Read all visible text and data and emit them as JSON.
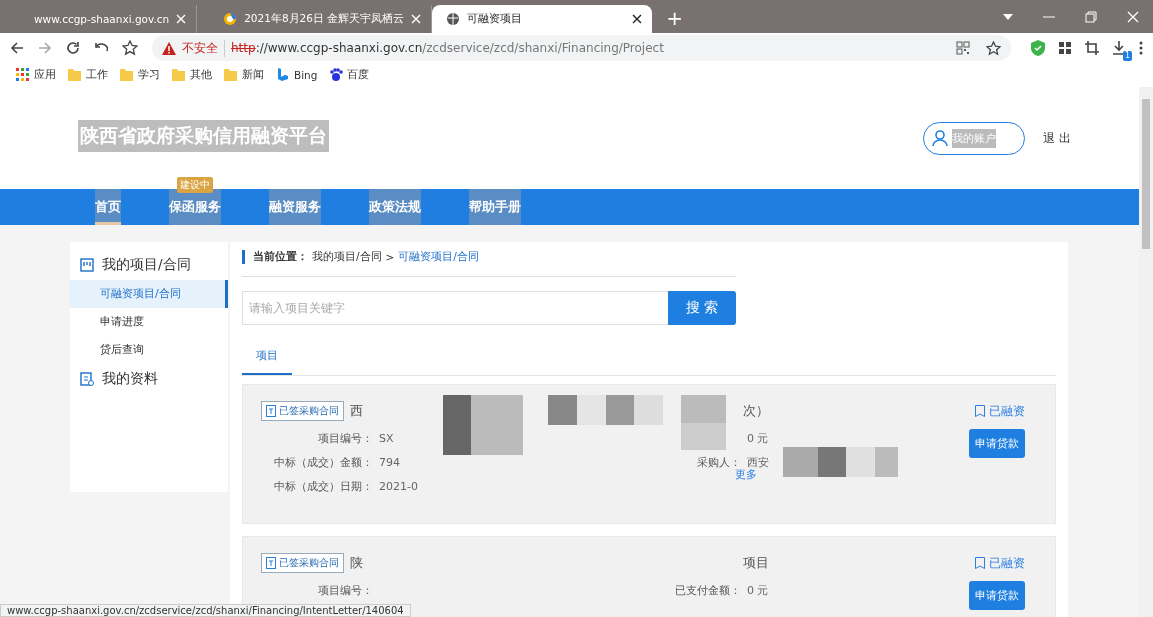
{
  "browser": {
    "tabs": [
      {
        "title": "www.ccgp-shaanxi.gov.cn",
        "kind": "plain",
        "selected": false
      },
      {
        "title": "2021年8月26日 金辉天宇凤栖云",
        "kind": "colorful",
        "selected": false
      },
      {
        "title": "可融资项目",
        "kind": "globe",
        "selected": true
      }
    ],
    "new_tab": "+",
    "address": {
      "warning": "不安全",
      "scheme": "http",
      "host": "://www.ccgp-shaanxi.gov.cn",
      "path": "/zcdservice/zcd/shanxi/Financing/Project"
    },
    "download_count": "1",
    "bookmarks": [
      {
        "label": "应用",
        "kind": "apps"
      },
      {
        "label": "工作",
        "kind": "folder"
      },
      {
        "label": "学习",
        "kind": "folder"
      },
      {
        "label": "其他",
        "kind": "folder"
      },
      {
        "label": "新闻",
        "kind": "folder"
      },
      {
        "label": "Bing",
        "kind": "bing"
      },
      {
        "label": "百度",
        "kind": "paw"
      }
    ]
  },
  "header": {
    "logo": "陕西省政府采购信用融资平台",
    "account": "我的账户",
    "logout": "退 出"
  },
  "nav": [
    {
      "label": "首页",
      "selected": true
    },
    {
      "label": "保函服务",
      "selected": false,
      "badge": "建设中"
    },
    {
      "label": "融资服务",
      "selected": false
    },
    {
      "label": "政策法规",
      "selected": false
    },
    {
      "label": "帮助手册",
      "selected": false
    }
  ],
  "sidebar": [
    {
      "label": "我的项目/合同",
      "kind": "board",
      "children": [
        {
          "label": "可融资项目/合同",
          "selected": true
        },
        {
          "label": "申请进度",
          "selected": false
        },
        {
          "label": "贷后查询",
          "selected": false
        }
      ]
    },
    {
      "label": "我的资料",
      "kind": "doc"
    }
  ],
  "breadcrumb": {
    "prefix": "当前位置：",
    "path": "我的项目/合同",
    "separator": ">",
    "current": "可融资项目/合同"
  },
  "search": {
    "placeholder": "请输入项目关键字",
    "button": "搜 索"
  },
  "content_tabs": [
    {
      "label": "项目",
      "selected": true
    }
  ],
  "projects": [
    {
      "tag": "已签采购合同",
      "title": "西",
      "title_end": "次）",
      "status": "已融资",
      "button": "申请贷款",
      "left": [
        {
          "label": "项目编号：",
          "value": "SX"
        },
        {
          "label": "中标（成交）金额：",
          "value": "794"
        },
        {
          "label": "中标（成交）日期：",
          "value": "2021-0"
        }
      ],
      "right": [
        {
          "value": "0 元"
        },
        {
          "label": "采购人：",
          "value": "西安"
        }
      ],
      "more": "更多"
    },
    {
      "tag": "已签采购合同",
      "title": "陕",
      "title_end": "项目",
      "status": "已融资",
      "button": "申请贷款",
      "left": [
        {
          "label": "项目编号："
        }
      ],
      "right": [
        {
          "label": "已支付金额：",
          "value": "0 元"
        }
      ]
    }
  ],
  "status_url": "www.ccgp-shaanxi.gov.cn/zcdservice/zcd/shanxi/Financing/IntentLetter/140604"
}
